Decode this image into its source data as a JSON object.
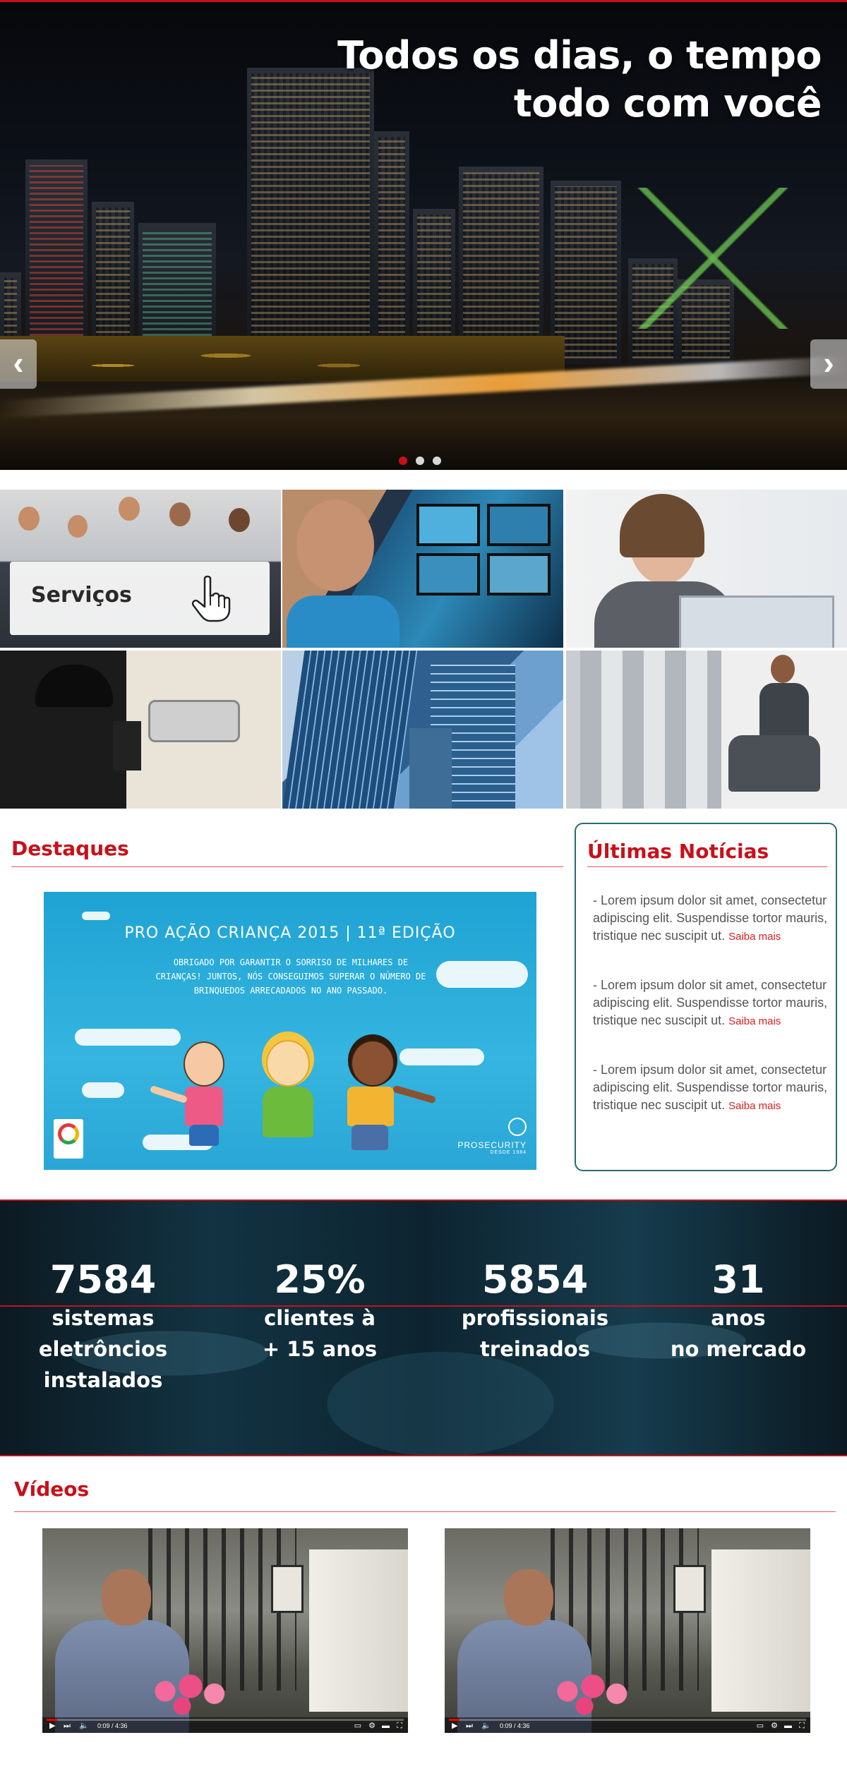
{
  "hero": {
    "title_line1": "Todos os dias, o tempo",
    "title_line2": "todo com você",
    "prev": "‹",
    "next": "›",
    "dots": 3,
    "active_dot": 0
  },
  "services": {
    "label": "Serviços",
    "icon": "pointer-hand-icon"
  },
  "highlights": {
    "title": "Destaques",
    "banner": {
      "title": "PRO AÇÃO CRIANÇA 2015 | 11ª EDIÇÃO",
      "subtitle": "Obrigado por garantir o sorriso de milhares de crianças! Juntos, nós conseguimos superar o número de brinquedos arrecadados no ano passado.",
      "brand": "PROSECURITY",
      "brand_tag": "DESDE 1984"
    }
  },
  "news": {
    "title": "Últimas Notícias",
    "items": [
      {
        "text": "- Lorem ipsum dolor sit amet, consectetur adipiscing elit. Suspendisse tortor mauris, tristique nec suscipit ut.",
        "more": "Saiba mais"
      },
      {
        "text": "- Lorem ipsum dolor sit amet, consectetur adipiscing elit. Suspendisse tortor mauris, tristique nec suscipit ut.",
        "more": "Saiba mais"
      },
      {
        "text": "- Lorem ipsum dolor sit amet, consectetur adipiscing elit. Suspendisse tortor mauris, tristique nec suscipit ut.",
        "more": "Saiba mais"
      }
    ]
  },
  "stats": [
    {
      "value": "7584",
      "label": "sistemas\neletrôncios\ninstalados"
    },
    {
      "value": "25%",
      "label": "clientes à\n+ 15 anos"
    },
    {
      "value": "5854",
      "label": "profissionais\ntreinados"
    },
    {
      "value": "31",
      "label": "anos\nno mercado"
    }
  ],
  "videos": {
    "title": "Vídeos",
    "items": [
      {
        "time": "0:09 / 4:36",
        "progress": 0.03
      },
      {
        "time": "0:09 / 4:36",
        "progress": 0.03
      }
    ]
  },
  "colors": {
    "accent": "#c8101a",
    "news_border": "#2a6b70",
    "link": "#d81e1e"
  }
}
